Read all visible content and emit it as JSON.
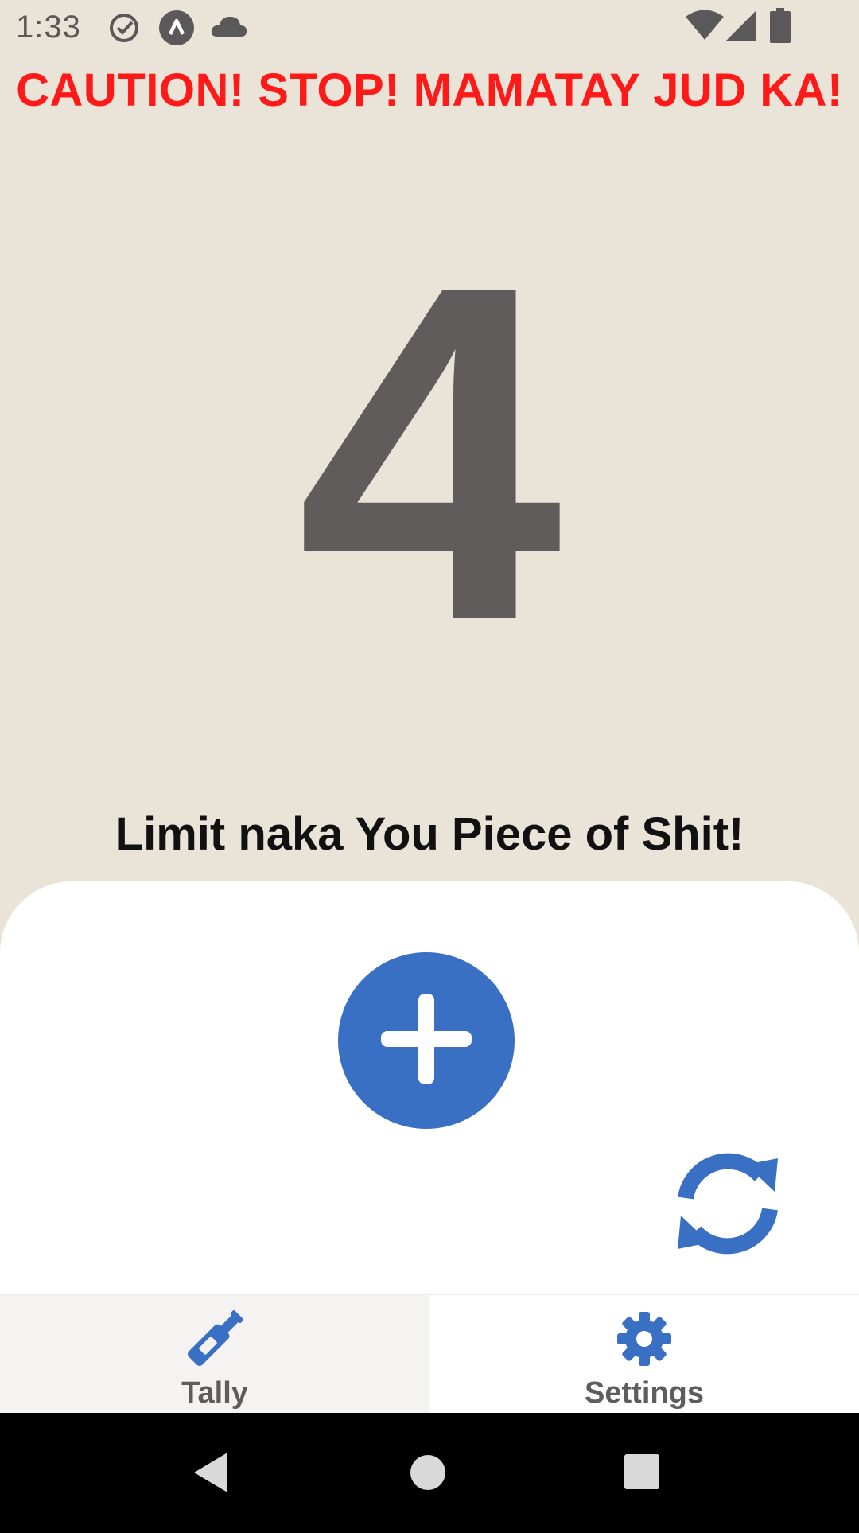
{
  "status_bar": {
    "time": "1:33",
    "icons_left": [
      "check-circle-icon",
      "app-logo-icon",
      "cloud-icon"
    ],
    "icons_right": [
      "wifi-icon",
      "signal-icon",
      "battery-icon"
    ]
  },
  "warning": {
    "text": "CAUTION! STOP! MAMATAY JUD KA!",
    "color": "#ff1a1a"
  },
  "counter": {
    "value": "4"
  },
  "message": {
    "text": "Limit naka You Piece of Shit!"
  },
  "actions": {
    "add_icon": "plus-icon",
    "reset_icon": "refresh-icon",
    "accent_color": "#3a70c4"
  },
  "tabs": [
    {
      "label": "Tally",
      "icon": "bottle-icon",
      "active": true
    },
    {
      "label": "Settings",
      "icon": "gear-icon",
      "active": false
    }
  ],
  "colors": {
    "background": "#e9e4d7",
    "counter": "#615c5c",
    "panel": "#ffffff"
  }
}
